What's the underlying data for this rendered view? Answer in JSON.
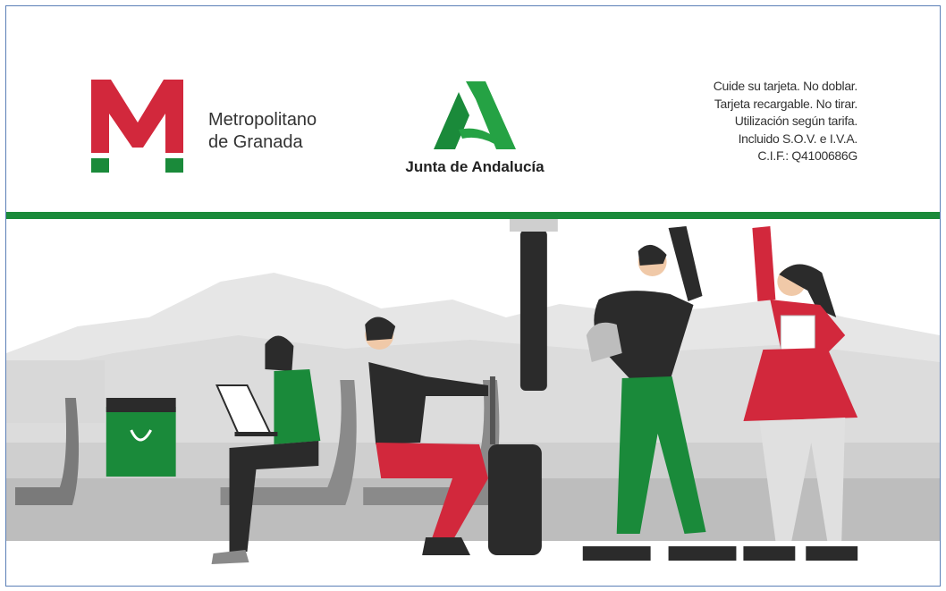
{
  "brand": {
    "logo_letter": "M",
    "name_line1": "Metropolitano",
    "name_line2": "de Granada"
  },
  "junta": {
    "name": "Junta de Andalucía"
  },
  "legal": {
    "lines": [
      "Cuide su tarjeta. No doblar.",
      "Tarjeta recargable. No tirar.",
      "Utilización según tarifa.",
      "Incluido S.O.V. e I.V.A.",
      "C.I.F.: Q4100686G"
    ]
  },
  "colors": {
    "metro_red": "#d2283c",
    "metro_green": "#1a8a3a",
    "junta_green": "#25a244",
    "rail_green": "#1a8a3a",
    "card_border": "#5b7fb6"
  },
  "illustration": {
    "icons": [
      "metro-logo-icon",
      "junta-logo-icon",
      "shopping-bag-icon",
      "laptop-icon",
      "suitcase-icon"
    ]
  }
}
